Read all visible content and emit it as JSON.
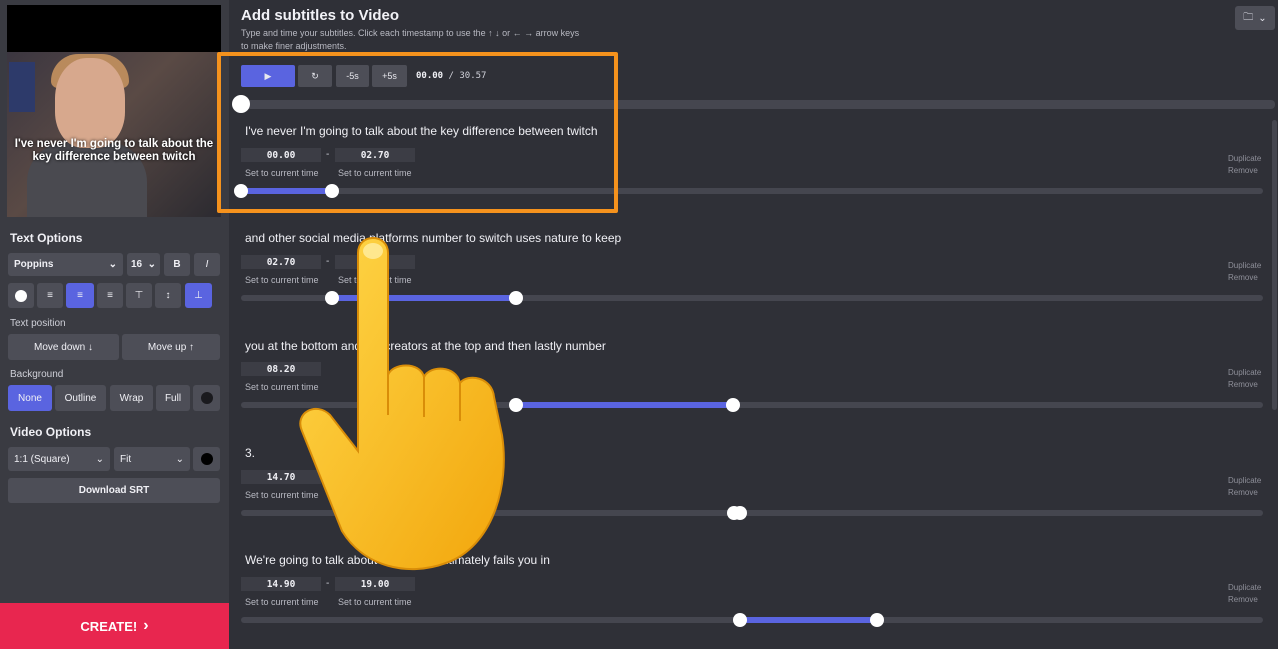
{
  "video": {
    "caption": "I've never I'm going to talk about the key difference between twitch"
  },
  "text_options": {
    "title": "Text Options",
    "font": "Poppins",
    "size": "16",
    "bold_label": "B",
    "italic_label": "I",
    "text_position_label": "Text position",
    "move_down": "Move down ↓",
    "move_up": "Move up ↑",
    "background_label": "Background",
    "bg_none": "None",
    "bg_outline": "Outline",
    "bg_wrap": "Wrap",
    "bg_full": "Full"
  },
  "video_options": {
    "title": "Video Options",
    "aspect": "1:1 (Square)",
    "fit": "Fit",
    "download_srt": "Download SRT"
  },
  "create_label": "CREATE!",
  "main": {
    "title": "Add subtitles to Video",
    "description": "Type and time your subtitles. Click each timestamp to use the ↑ ↓ or ← → arrow keys to make finer adjustments."
  },
  "player": {
    "minus5": "-5s",
    "plus5": "+5s",
    "current": "00.00",
    "separator": "/",
    "duration": "30.57",
    "progress": 0.0
  },
  "labels": {
    "set_to_current": "Set to current time",
    "duplicate": "Duplicate",
    "remove": "Remove",
    "dash": "-"
  },
  "subtitles": [
    {
      "text": "I've never I'm going to talk about the key difference between twitch",
      "start": "00.00",
      "end": "02.70"
    },
    {
      "text": "and other social media platforms number to switch uses nature to keep",
      "start": "02.70",
      "end": ""
    },
    {
      "text": "you at the bottom and the creators at the top and then lastly number",
      "start": "08.20",
      "end": ""
    },
    {
      "text": "3.",
      "start": "14.70",
      "end": ""
    },
    {
      "text": "We're going to talk about why twitch ultimately fails you in",
      "start": "14.90",
      "end": "19.00"
    }
  ],
  "colors": {
    "accent": "#5a64e0",
    "create": "#e8264f",
    "highlight": "#f5921d"
  }
}
